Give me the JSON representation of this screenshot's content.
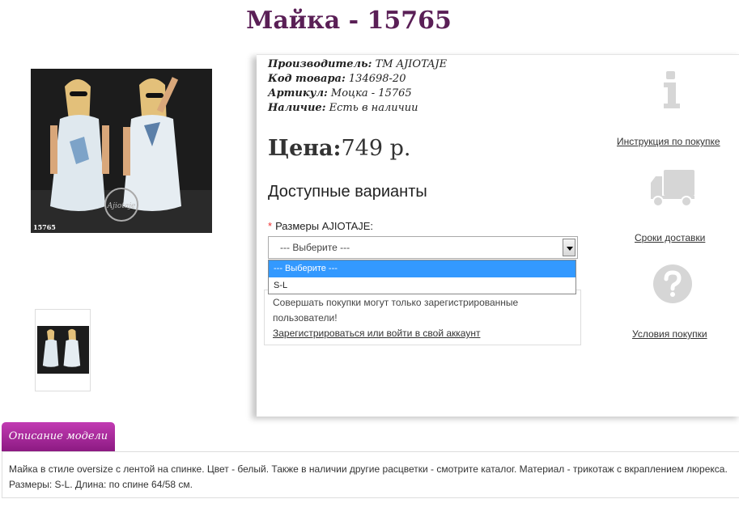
{
  "product": {
    "title": "Майка - 15765",
    "photo_code": "15765"
  },
  "specs": {
    "manufacturer_label": "Производитель:",
    "manufacturer_value": "TM AJIOTAJE",
    "code_label": "Код товара:",
    "code_value": "134698-20",
    "article_label": "Артикул:",
    "article_value": "Моцка - 15765",
    "stock_label": "Наличие:",
    "stock_value": "Есть в наличии"
  },
  "price": {
    "label": "Цена:",
    "value": "749 р."
  },
  "options": {
    "heading": "Доступные варианты",
    "size_label": "Размеры AJIOTAJE:",
    "required_mark": "*",
    "selected": "--- Выберите ---",
    "list": [
      "--- Выберите ---",
      "S-L"
    ]
  },
  "notice": {
    "line1": "Совершать покупки могут только зарегистрированные",
    "line2": "пользователи!",
    "link": "Зарегистрироваться или войти в свой аккаунт"
  },
  "sidebar": {
    "instructions": "Инструкция по покупке",
    "delivery": "Сроки доставки",
    "terms": "Условия покупки",
    "icons": [
      "info-icon",
      "truck-icon",
      "question-icon"
    ]
  },
  "description": {
    "tab_label": "Описание модели",
    "line1": "Майка в стиле oversize с лентой на спинке. Цвет - белый. Также в наличии другие расцветки - смотрите каталог. Материал - трикотаж с вкраплением люрекса.",
    "line2": "Размеры: S-L. Длина: по спине 64/58 см."
  },
  "colors": {
    "title": "#5a1f56",
    "tab": "#a42a99",
    "highlight": "#3399ff",
    "icon_gray": "#d6d6d6"
  }
}
